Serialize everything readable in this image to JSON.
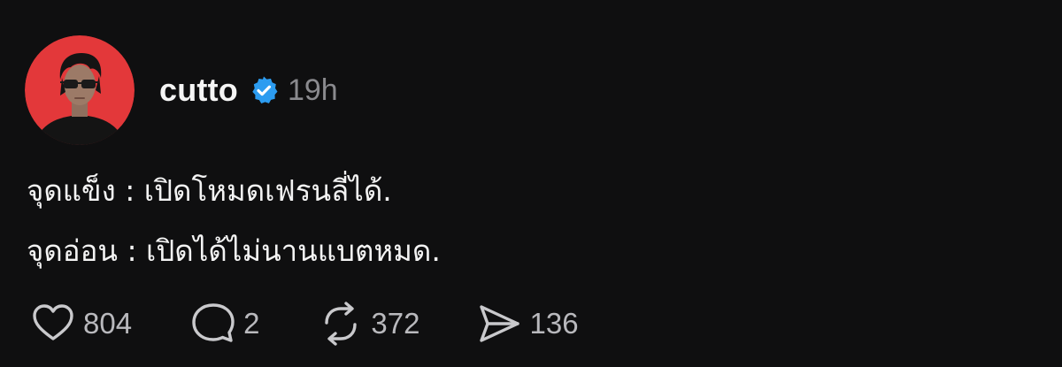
{
  "post": {
    "author": {
      "username": "cutto",
      "verified": true,
      "avatar_bg": "#e3383a"
    },
    "timestamp": "19h",
    "content": {
      "lines": [
        "จุดแข็ง : เปิดโหมดเฟรนลี่ได้.",
        "จุดอ่อน : เปิดได้ไม่นานแบตหมด."
      ]
    },
    "actions": {
      "like": {
        "icon": "heart-icon",
        "count": "804"
      },
      "reply": {
        "icon": "comment-icon",
        "count": "2"
      },
      "repost": {
        "icon": "repost-icon",
        "count": "372"
      },
      "share": {
        "icon": "send-icon",
        "count": "136"
      }
    }
  },
  "colors": {
    "background": "#0f0f10",
    "text": "#f3f3f3",
    "muted": "#8a8a8e",
    "verified_badge": "#2c9cf0"
  }
}
